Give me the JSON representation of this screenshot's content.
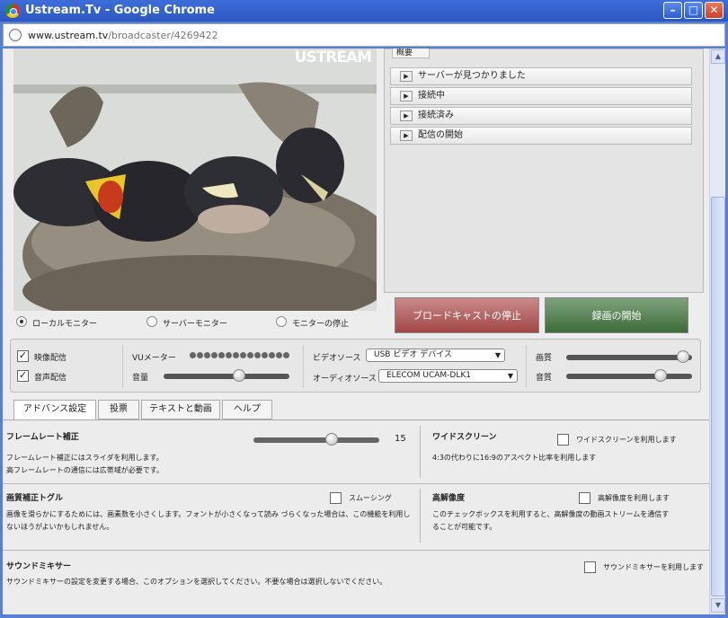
{
  "window": {
    "title": "Ustream.Tv - Google Chrome"
  },
  "address": {
    "host": "www.ustream.tv",
    "path": "/broadcaster/4269422"
  },
  "video": {
    "watermark": "USTREAM"
  },
  "monitors": [
    {
      "label": "ローカルモニター",
      "selected": true
    },
    {
      "label": "サーバーモニター",
      "selected": false
    },
    {
      "label": "モニターの停止",
      "selected": false
    }
  ],
  "status": {
    "tab": "概要",
    "items": [
      "サーバーが見つかりました",
      "接続中",
      "接続済み",
      "配信の開始"
    ]
  },
  "buttons": {
    "stop_broadcast": "ブロードキャストの停止",
    "start_record": "録画の開始"
  },
  "controls": {
    "video_out": "映像配信",
    "audio_out": "音声配信",
    "vu_label": "VUメーター",
    "volume_label": "音量",
    "volume_level": 0.6,
    "video_source_label": "ビデオソース",
    "video_source": "USB ビデオ デバイス",
    "audio_source_label": "オーディオソース",
    "audio_source": "ELECOM UCAM-DLK1",
    "quality_label": "画質",
    "quality_level": 0.93,
    "sound_label": "音質",
    "sound_level": 0.75
  },
  "tabs": [
    "アドバンス設定",
    "投票",
    "テキストと動画",
    "ヘルプ"
  ],
  "advanced": {
    "framerate": {
      "title": "フレームレート補正",
      "desc1": "フレームレート補正にはスライダを利用します。",
      "desc2": "高フレームレートの通信には広帯域が必要です。",
      "value": "15",
      "level": 0.62
    },
    "widescreen": {
      "title": "ワイドスクリーン",
      "check": "ワイドスクリーンを利用します",
      "desc": "4:3の代わりに16:9のアスペクト比率を利用します"
    },
    "smoothing": {
      "title": "画質補正トグル",
      "check": "スムーシング",
      "desc1": "画像を滑らかにするためには、画素数を小さくします。フォントが小さくなって読み づらくなった場合は、この機能を利用し",
      "desc2": "ないほうがよいかもしれません。"
    },
    "hires": {
      "title": "高解像度",
      "check": "高解像度を利用します",
      "desc1": "このチェックボックスを利用すると、高解像度の動画ストリームを通信す",
      "desc2": "ることが可能です。"
    },
    "mixer": {
      "title": "サウンドミキサー",
      "check": "サウンドミキサーを利用します",
      "desc": "サウンドミキサーの設定を変更する場合、このオプションを選択してください。不要な場合は選択しないでください。"
    }
  }
}
